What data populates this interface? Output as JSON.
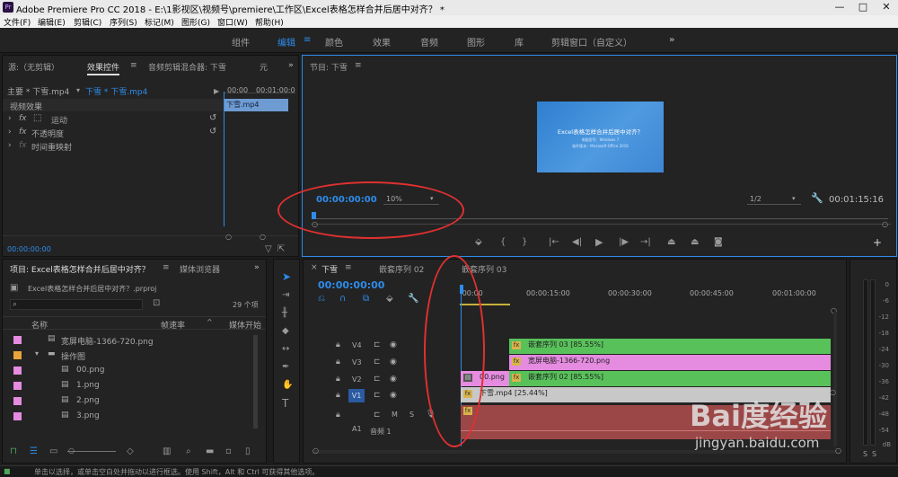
{
  "window": {
    "app_icon": "Pr",
    "title": "Adobe Premiere Pro CC 2018 - E:\\1影视区\\视频号\\premiere\\工作区\\Excel表格怎样合并后居中对齐？ *",
    "min": "—",
    "max": "□",
    "close": "✕"
  },
  "menu": [
    "文件(F)",
    "编辑(E)",
    "剪辑(C)",
    "序列(S)",
    "标记(M)",
    "图形(G)",
    "窗口(W)",
    "帮助(H)"
  ],
  "workspaces": [
    "组件",
    "编辑",
    "颜色",
    "效果",
    "音频",
    "图形",
    "库",
    "剪辑窗口（自定义）"
  ],
  "workspace_more": "»",
  "source_panel": {
    "tabs": [
      "源:（无剪辑）",
      "效果控件",
      "音频剪辑混合器: 下雪",
      "元"
    ],
    "master": "主要 * 下雪.mp4",
    "clip": "下雪 * 下雪.mp4",
    "ruler_start": "00:00",
    "ruler_mid": "00:01:00:0",
    "clip_bar": "下雪.mp4",
    "section": "视频效果",
    "effects": [
      "运动",
      "不透明度",
      "时间重映射"
    ],
    "fx_label": "fx",
    "timecode": "00:00:00:00"
  },
  "program": {
    "tab": "节目: 下雪",
    "video_title": "Excel表格怎样合并后居中对齐？",
    "video_line1": "电脑型号：Windows 7",
    "video_line2": "软件版本：Microsoft Office 2016",
    "timecode": "00:00:00:00",
    "zoom": "10%",
    "resolution": "1/2",
    "duration": "00:01:15:16"
  },
  "project": {
    "tabs": [
      "项目: Excel表格怎样合并后居中对齐？",
      "媒体浏览器"
    ],
    "file": "Excel表格怎样合并后居中对齐？.prproj",
    "count": "29 个项",
    "cols": [
      "名称",
      "帧速率",
      "媒体开始"
    ],
    "items": [
      {
        "name": "宽屏电脑-1366-720.png",
        "color": "#e58be0",
        "indent": 1
      },
      {
        "name": "操作图",
        "color": "#e8a33a",
        "indent": 1,
        "folder": true
      },
      {
        "name": "00.png",
        "color": "#e58be0",
        "indent": 2
      },
      {
        "name": "1.png",
        "color": "#e58be0",
        "indent": 2
      },
      {
        "name": "2.png",
        "color": "#e58be0",
        "indent": 2
      },
      {
        "name": "3.png",
        "color": "#e58be0",
        "indent": 2
      }
    ]
  },
  "timeline": {
    "tabs": [
      "下雪",
      "嵌套序列 02",
      "嵌套序列 03"
    ],
    "timecode": "00:00:00:00",
    "ruler": [
      ":00:00",
      "00:00:15:00",
      "00:00:30:00",
      "00:00:45:00",
      "00:01:00:00"
    ],
    "tracks": [
      "V4",
      "V3",
      "V2",
      "V1",
      "A1"
    ],
    "clips": {
      "v4": "嵌套序列 03 [85.55%]",
      "v3": "宽屏电脑-1366-720.png",
      "v2a": "00.png",
      "v2b": "嵌套序列 02 [85.55%]",
      "v1": "下雪.mp4 [25.44%]"
    },
    "audio_label": "音频 1",
    "m": "M",
    "s": "S"
  },
  "meter_labels": [
    "0",
    "-6",
    "-12",
    "-18",
    "-24",
    "-30",
    "-36",
    "-42",
    "-48",
    "-54",
    "dB"
  ],
  "status": "单击以选择，或单击空白处并拖动以进行框选。使用 Shift，Alt 和 Ctrl 可获得其他选项。",
  "watermark": {
    "main": "Bai度经验",
    "url": "jingyan.baidu.com"
  },
  "colors": {
    "accent": "#2d8ceb",
    "green_clip": "#58c15a",
    "pink_clip": "#e58be0",
    "audio_clip": "#9c4747"
  }
}
